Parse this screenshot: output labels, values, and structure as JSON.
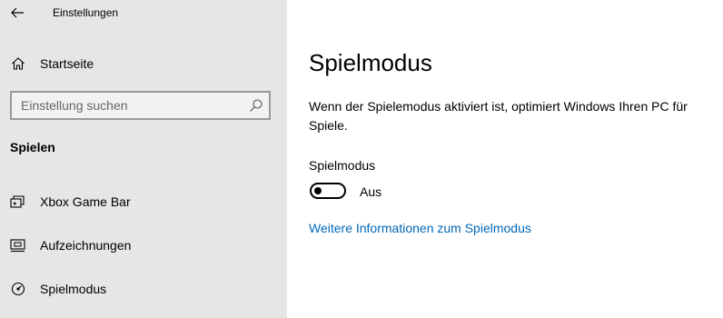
{
  "window": {
    "title": "Einstellungen"
  },
  "sidebar": {
    "home_label": "Startseite",
    "search": {
      "placeholder": "Einstellung suchen",
      "value": ""
    },
    "section_title": "Spielen",
    "items": [
      {
        "label": "Xbox Game Bar",
        "icon": "game-bar-icon"
      },
      {
        "label": "Aufzeichnungen",
        "icon": "captures-icon"
      },
      {
        "label": "Spielmodus",
        "icon": "game-mode-icon"
      }
    ]
  },
  "main": {
    "title": "Spielmodus",
    "description": "Wenn der Spielemodus aktiviert ist, optimiert Windows Ihren PC für Spiele.",
    "setting": {
      "label": "Spielmodus",
      "state": "Aus",
      "enabled": false
    },
    "link_label": "Weitere Informationen zum Spielmodus"
  },
  "colors": {
    "sidebar_bg": "#e6e6e6",
    "content_bg": "#ffffff",
    "link": "#0067b8"
  }
}
